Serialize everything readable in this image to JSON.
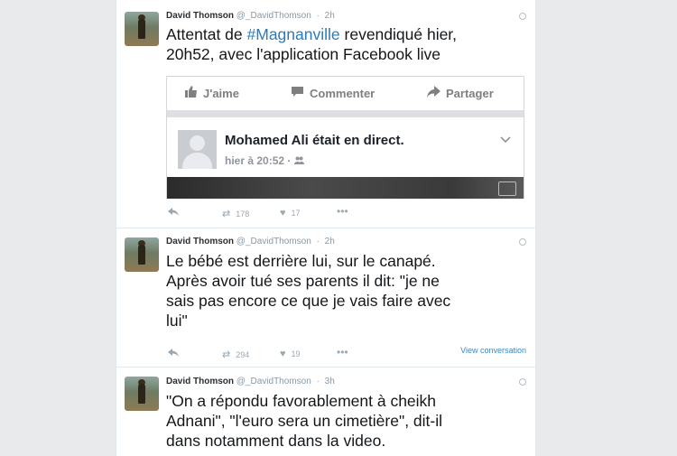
{
  "colors": {
    "accent": "#2b7bb9",
    "link": "#3b88c3",
    "muted": "#8899a6"
  },
  "tweets": [
    {
      "name": "David Thomson",
      "handle": "@_DavidThomson",
      "time": "2h",
      "text_before": "Attentat de ",
      "hashtag": "#Magnanville",
      "text_after": " revendiqué hier,\n20h52, avec l'application Facebook live",
      "retweets": "178",
      "likes": "17"
    },
    {
      "name": "David Thomson",
      "handle": "@_DavidThomson",
      "time": "2h",
      "text": "Le bébé est derrière lui, sur le canapé.\nAprès avoir tué ses parents il dit: \"je ne\nsais pas encore ce que je vais faire avec\nlui\"",
      "retweets": "294",
      "likes": "19",
      "view_conversation": "View conversation"
    },
    {
      "name": "David Thomson",
      "handle": "@_DavidThomson",
      "time": "3h",
      "text": "\"On a répondu favorablement à cheikh\nAdnani\", \"l'euro sera un cimetière\", dit-il\ndans notamment dans la video."
    }
  ],
  "facebook_card": {
    "like_label": "J'aime",
    "comment_label": "Commenter",
    "share_label": "Partager",
    "post_title": "Mohamed Ali était en direct.",
    "post_time": "hier à 20:52 · ",
    "icons": [
      "thumbs-up-icon",
      "comment-icon",
      "share-arrow-icon",
      "friends-icon",
      "chevron-down-icon"
    ]
  }
}
